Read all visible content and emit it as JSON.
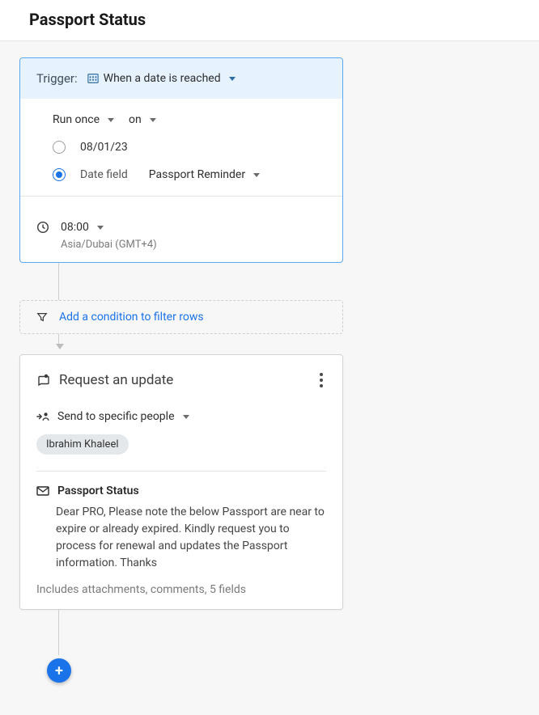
{
  "page": {
    "title": "Passport Status"
  },
  "trigger": {
    "label": "Trigger:",
    "type_label": "When a date is reached",
    "run_mode": "Run once",
    "on_label": "on",
    "fixed_date": "08/01/23",
    "date_field_label": "Date field",
    "date_field_value": "Passport Reminder",
    "time": "08:00",
    "timezone": "Asia/Dubai (GMT+4)"
  },
  "condition": {
    "add_label": "Add a condition to filter rows"
  },
  "action": {
    "title": "Request an update",
    "send_label": "Send to specific people",
    "recipients": [
      "Ibrahim Khaleel"
    ],
    "subject": "Passport Status",
    "body": "Dear PRO, Please note the below Passport are near to expire or already expired. Kindly request you to process for renewal and updates the Passport information. Thanks",
    "includes": "Includes attachments, comments, 5 fields"
  },
  "fab": {
    "label": "+"
  }
}
